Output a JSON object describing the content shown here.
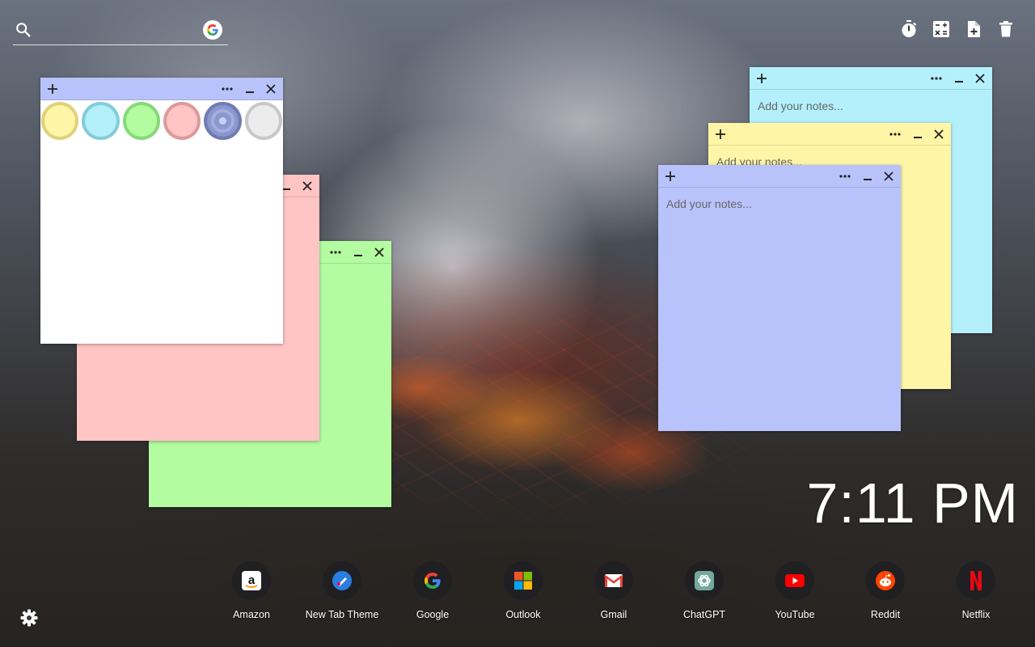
{
  "search": {
    "placeholder": ""
  },
  "tools": [
    "timer-icon",
    "calculator-icon",
    "new-note-icon",
    "trash-icon"
  ],
  "notes": {
    "placeholder": "Add your notes...",
    "colors": {
      "white": "#ffffff",
      "pink": "#ffc4c4",
      "green": "#b3fca0",
      "cyan": "#b3f0fc",
      "yellow": "#fff5a6",
      "blue": "#b8c3fc"
    }
  },
  "palette": [
    {
      "name": "yellow",
      "fill": "#fff5a6",
      "border": "#e0d27a"
    },
    {
      "name": "cyan",
      "fill": "#b3f0fc",
      "border": "#84ccd9"
    },
    {
      "name": "green",
      "fill": "#b3fca0",
      "border": "#86d977"
    },
    {
      "name": "pink",
      "fill": "#ffc4c4",
      "border": "#dc9a9a"
    },
    {
      "name": "blue",
      "fill": "#8a96cc",
      "border": "#6f7cb4"
    },
    {
      "name": "gray",
      "fill": "#ececec",
      "border": "#c8c8c8"
    }
  ],
  "clock": {
    "time": "7:11 PM"
  },
  "shortcuts": [
    {
      "label": "Amazon",
      "icon": "amazon-icon"
    },
    {
      "label": "New Tab Theme",
      "icon": "new-tab-theme-icon"
    },
    {
      "label": "Google",
      "icon": "google-icon"
    },
    {
      "label": "Outlook",
      "icon": "outlook-icon"
    },
    {
      "label": "Gmail",
      "icon": "gmail-icon"
    },
    {
      "label": "ChatGPT",
      "icon": "chatgpt-icon"
    },
    {
      "label": "YouTube",
      "icon": "youtube-icon"
    },
    {
      "label": "Reddit",
      "icon": "reddit-icon"
    },
    {
      "label": "Netflix",
      "icon": "netflix-icon"
    }
  ]
}
